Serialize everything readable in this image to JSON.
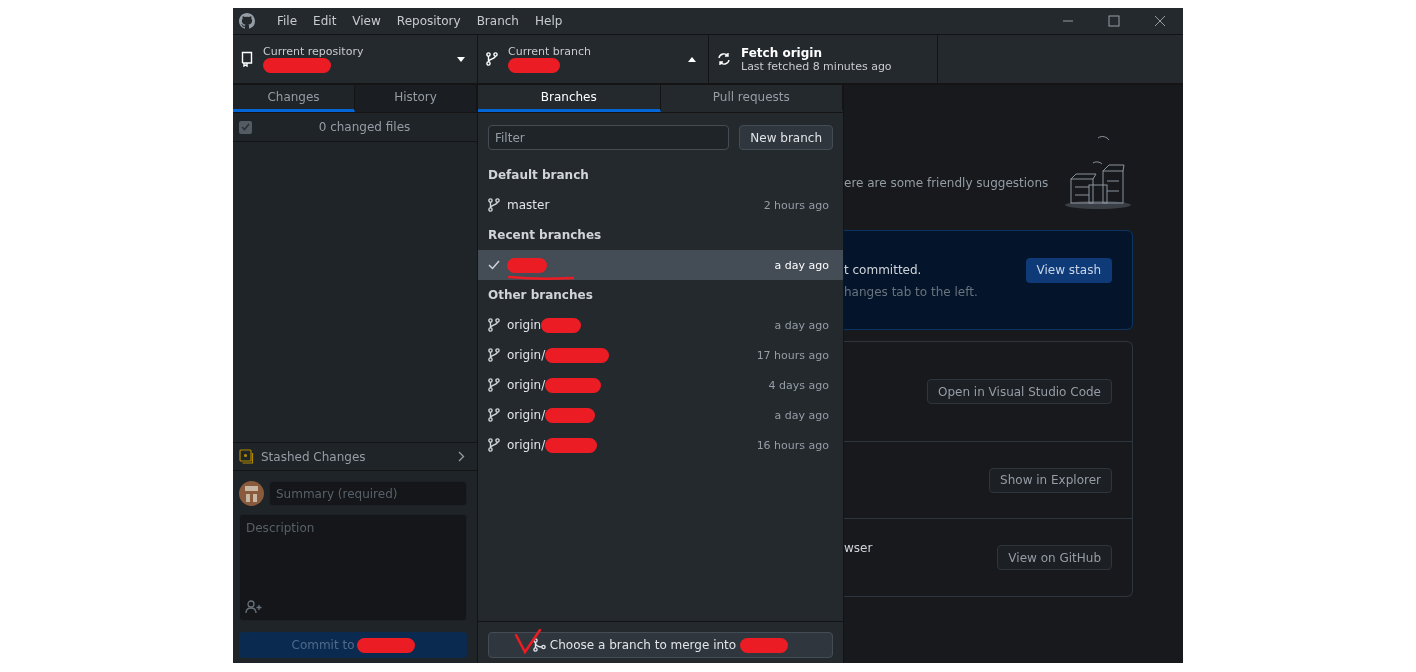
{
  "window": {
    "menu": [
      "File",
      "Edit",
      "View",
      "Repository",
      "Branch",
      "Help"
    ]
  },
  "toolbar": {
    "repository": {
      "label": "Current repository",
      "redacted": true
    },
    "branch": {
      "label": "Current branch",
      "expanded": true,
      "redacted": true
    },
    "fetch": {
      "title": "Fetch origin",
      "subtitle": "Last fetched 8 minutes ago"
    }
  },
  "sidebar": {
    "tabs": [
      {
        "label": "Changes",
        "selected": true
      },
      {
        "label": "History",
        "selected": false
      }
    ],
    "changes": {
      "count": "0 changed files",
      "checked": true
    },
    "stash": {
      "label": "Stashed Changes"
    },
    "summary": {
      "placeholder": "Summary (required)"
    },
    "description": {
      "placeholder": "Description"
    },
    "commit_button": {
      "label": "Commit to",
      "redacted": true
    }
  },
  "branch_menu": {
    "tabs": [
      {
        "label": "Branches",
        "selected": true
      },
      {
        "label": "Pull requests",
        "selected": false
      }
    ],
    "filter": {
      "placeholder": "Filter"
    },
    "new_branch": "New branch",
    "groups": [
      {
        "title": "Default branch",
        "items": [
          {
            "name": "master",
            "time": "2 hours ago",
            "selected": false,
            "redacted": false
          }
        ]
      },
      {
        "title": "Recent branches",
        "items": [
          {
            "time": "a day ago",
            "selected": true,
            "redacted": true,
            "underlined": true
          }
        ]
      },
      {
        "title": "Other branches",
        "items": [
          {
            "name": "origin",
            "time": "a day ago",
            "selected": false,
            "redacted": true
          },
          {
            "name": "origin/",
            "time": "17 hours ago",
            "selected": false,
            "redacted": true
          },
          {
            "name": "origin/",
            "time": "4 days ago",
            "selected": false,
            "redacted": true
          },
          {
            "name": "origin/",
            "time": "a day ago",
            "selected": false,
            "redacted": true
          },
          {
            "name": "origin/",
            "time": "16 hours ago",
            "selected": false,
            "redacted": true
          }
        ]
      }
    ],
    "merge_button": {
      "label": "Choose a branch to merge into",
      "redacted": true,
      "check_scribble": true
    }
  },
  "main": {
    "intro": "ere are some friendly suggestions",
    "stash_card": {
      "lines": [
        "t committed.",
        "hanges tab to the left."
      ],
      "button": "View stash"
    },
    "actions": [
      {
        "button": "Open in Visual Studio Code"
      },
      {
        "button": "Show in Explorer"
      },
      {
        "text": "wser",
        "button": "View on GitHub"
      }
    ]
  }
}
